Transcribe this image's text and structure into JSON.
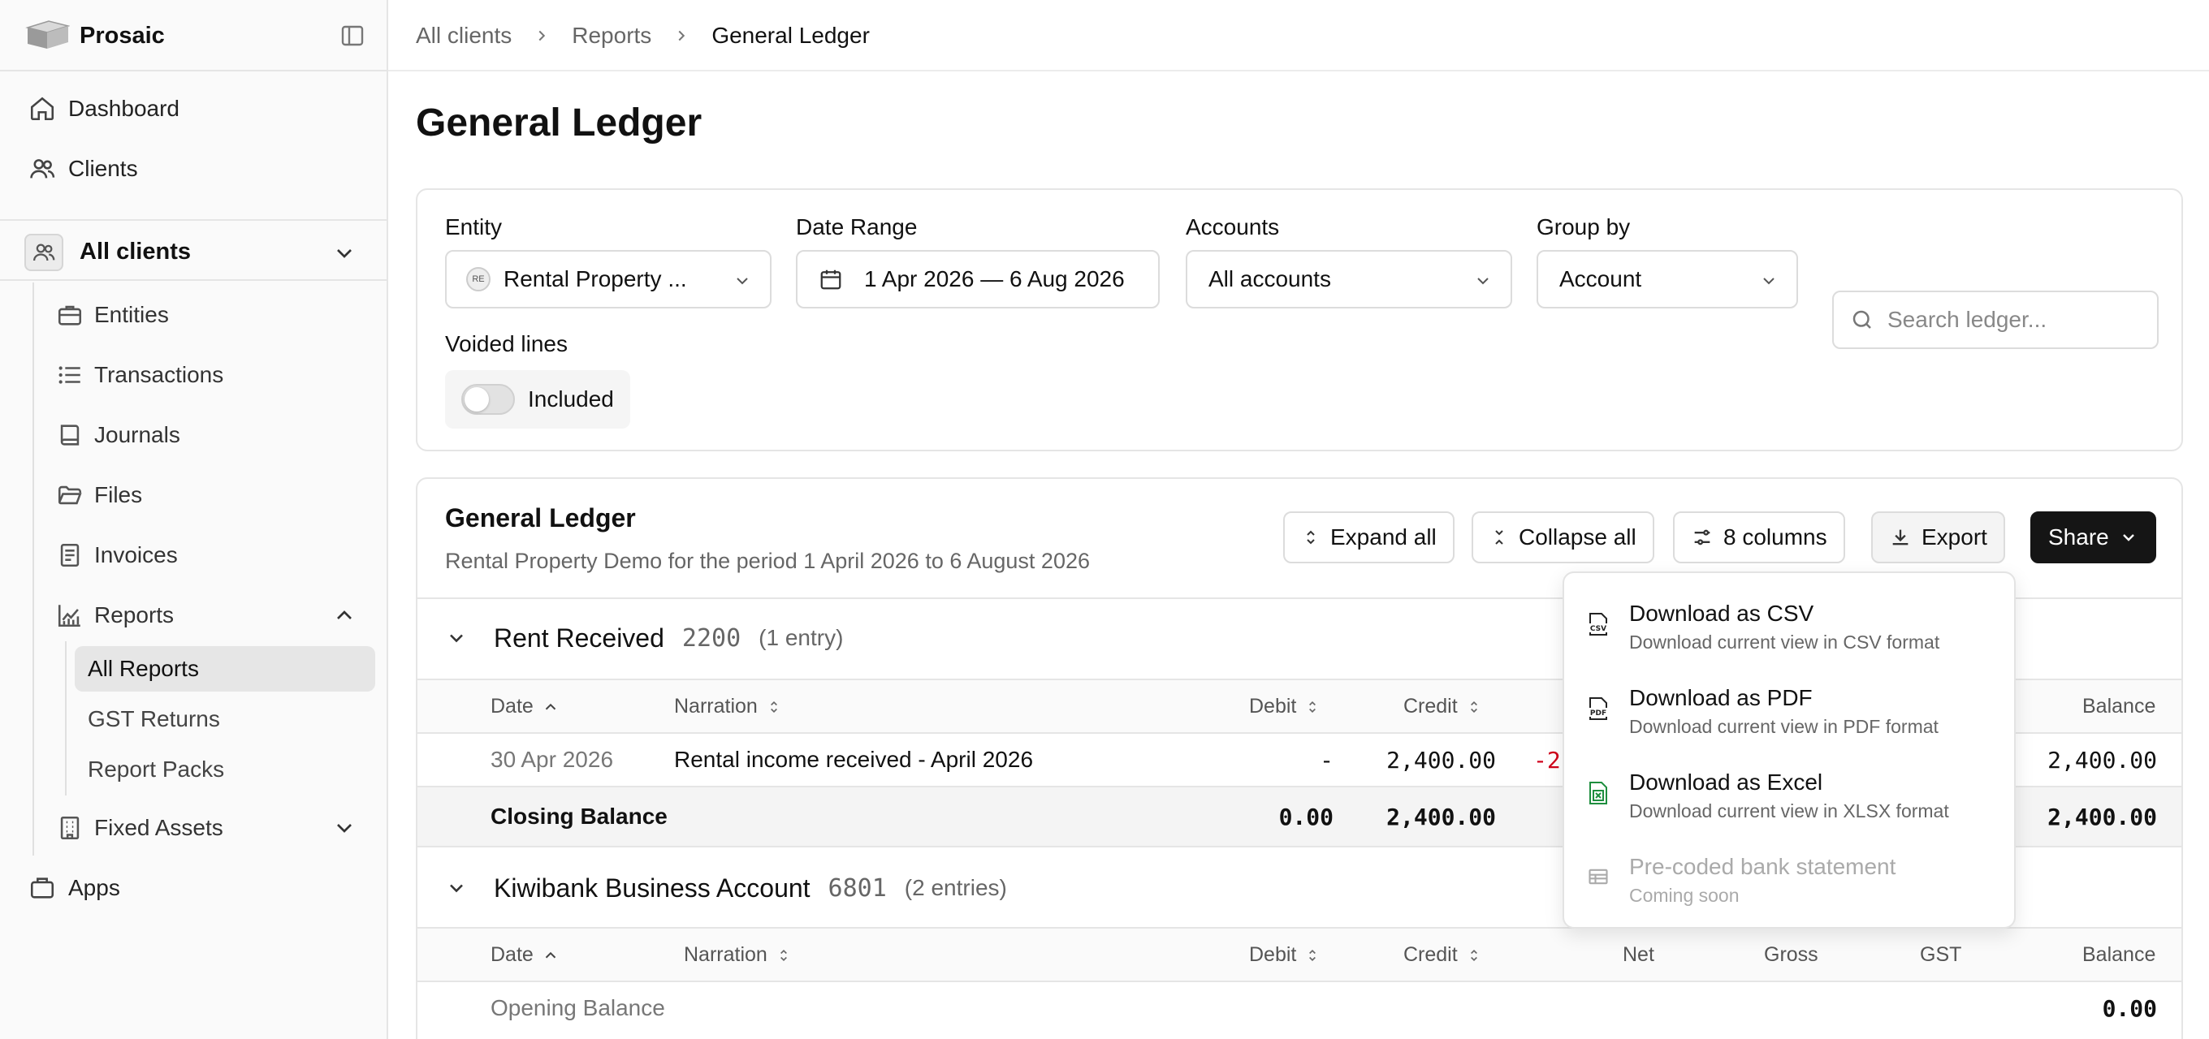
{
  "app": {
    "name": "Prosaic"
  },
  "sidebar": {
    "dashboard": "Dashboard",
    "clients": "Clients",
    "group_label": "All clients",
    "items": {
      "entities": "Entities",
      "transactions": "Transactions",
      "journals": "Journals",
      "files": "Files",
      "invoices": "Invoices",
      "reports": "Reports",
      "fixed_assets": "Fixed Assets"
    },
    "reports_sub": {
      "all_reports": "All Reports",
      "gst_returns": "GST Returns",
      "report_packs": "Report Packs"
    },
    "apps": "Apps"
  },
  "breadcrumbs": [
    "All clients",
    "Reports",
    "General Ledger"
  ],
  "page": {
    "title": "General Ledger"
  },
  "filters": {
    "entity": {
      "label": "Entity",
      "badge": "RE",
      "value": "Rental Property ..."
    },
    "date_range": {
      "label": "Date Range",
      "value": "1 Apr 2026 — 6 Aug 2026"
    },
    "accounts": {
      "label": "Accounts",
      "value": "All accounts"
    },
    "group_by": {
      "label": "Group by",
      "value": "Account"
    },
    "voided": {
      "label": "Voided lines",
      "toggle_label": "Included",
      "enabled": false
    },
    "search": {
      "placeholder": "Search ledger..."
    }
  },
  "ledger": {
    "title": "General Ledger",
    "subtitle": "Rental Property Demo for the period 1 April 2026 to 6 August 2026",
    "toolbar": {
      "expand_all": "Expand all",
      "collapse_all": "Collapse all",
      "columns": "8 columns",
      "export": "Export",
      "share": "Share"
    },
    "sections": [
      {
        "name": "Rent Received",
        "code": "2200",
        "count": "(1 entry)",
        "columns": {
          "date": "Date",
          "narration": "Narration",
          "debit": "Debit",
          "credit": "Credit",
          "balance": "Balance"
        },
        "rows": [
          {
            "date": "30 Apr 2026",
            "narration": "Rental income received - April 2026",
            "debit": "-",
            "credit": "2,400.00",
            "net": "-2",
            "balance": "2,400.00"
          }
        ],
        "closing": {
          "label": "Closing Balance",
          "debit": "0.00",
          "credit": "2,400.00",
          "balance": "2,400.00"
        }
      },
      {
        "name": "Kiwibank Business Account",
        "code": "6801",
        "count": "(2 entries)",
        "columns": {
          "date": "Date",
          "narration": "Narration",
          "debit": "Debit",
          "credit": "Credit",
          "net": "Net",
          "gross": "Gross",
          "gst": "GST",
          "balance": "Balance"
        },
        "opening": {
          "label": "Opening Balance",
          "balance": "0.00"
        }
      }
    ]
  },
  "export_menu": {
    "items": [
      {
        "title": "Download as CSV",
        "desc": "Download current view in CSV format",
        "icon_text": "CSV"
      },
      {
        "title": "Download as PDF",
        "desc": "Download current view in PDF format",
        "icon_text": "PDF"
      },
      {
        "title": "Download as Excel",
        "desc": "Download current view in XLSX format"
      },
      {
        "title": "Pre-coded bank statement",
        "desc": "Coming soon"
      }
    ]
  },
  "colors": {
    "accent_dark": "#151515",
    "negative": "#d0021b",
    "excel_green": "#1e8e3e"
  }
}
